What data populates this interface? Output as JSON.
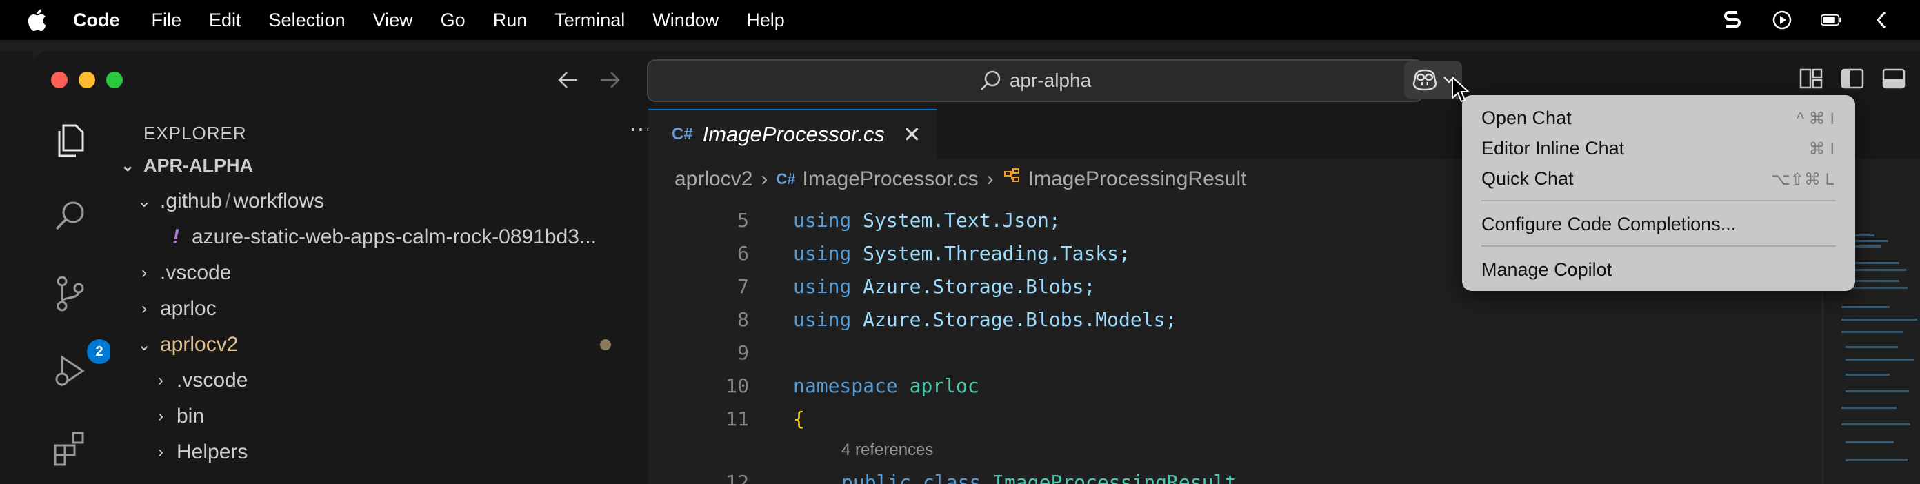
{
  "menubar": {
    "app_name": "Code",
    "items": [
      "File",
      "Edit",
      "Selection",
      "View",
      "Go",
      "Run",
      "Terminal",
      "Window",
      "Help"
    ]
  },
  "titlebar": {
    "search_text": "apr-alpha"
  },
  "activity_bar": {
    "scm_badge": "2"
  },
  "sidebar": {
    "title": "EXPLORER",
    "more": "⋯",
    "root": "APR-ALPHA",
    "tree": {
      "github_dir": ".github",
      "github_sep": "/",
      "github_sub": "workflows",
      "workflow_file": "azure-static-web-apps-calm-rock-0891bd3...",
      "vscode": ".vscode",
      "aprloc": "aprloc",
      "aprlocv2": "aprlocv2",
      "v2_vscode": ".vscode",
      "v2_bin": "bin",
      "v2_helpers": "Helpers"
    }
  },
  "editor": {
    "tab_label": "ImageProcessor.cs",
    "breadcrumb": [
      "aprlocv2",
      "ImageProcessor.cs",
      "ImageProcessingResult"
    ],
    "code_lines": [
      {
        "num": "5",
        "kw": "using",
        "rest": "System.Text.Json;"
      },
      {
        "num": "6",
        "kw": "using",
        "rest": "System.Threading.Tasks;"
      },
      {
        "num": "7",
        "kw": "using",
        "rest": "Azure.Storage.Blobs;"
      },
      {
        "num": "8",
        "kw": "using",
        "rest": "Azure.Storage.Blobs.Models;"
      },
      {
        "num": "9",
        "kw": "",
        "rest": ""
      },
      {
        "num": "10",
        "kw": "namespace",
        "rest": "aprloc"
      },
      {
        "num": "11",
        "kw": "",
        "rest": "{"
      }
    ],
    "codelens": "4 references",
    "line12": {
      "num": "12",
      "kw1": "public",
      "kw2": "class",
      "type": "ImageProcessingResult"
    }
  },
  "copilot_menu": {
    "items": [
      {
        "label": "Open Chat",
        "shortcut": "^ ⌘ I"
      },
      {
        "label": "Editor Inline Chat",
        "shortcut": "⌘ I"
      },
      {
        "label": "Quick Chat",
        "shortcut": "⌥⇧⌘ L"
      },
      {
        "label": "Configure Code Completions...",
        "shortcut": ""
      },
      {
        "label": "Manage Copilot",
        "shortcut": ""
      }
    ]
  },
  "colors": {
    "accent": "#0078d4",
    "modified": "#e2c08d",
    "keyword": "#569cd6",
    "type": "#4ec9b0"
  }
}
